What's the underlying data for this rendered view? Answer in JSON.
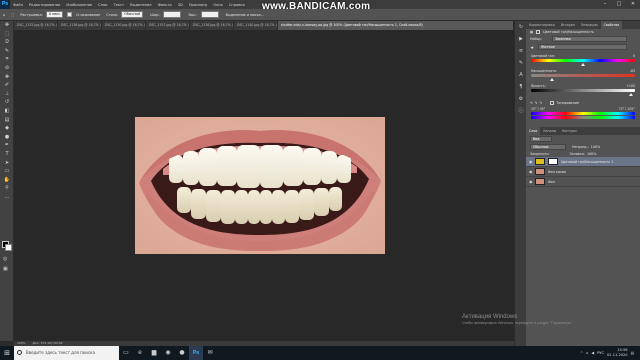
{
  "app": {
    "logo": "Ps",
    "menu": [
      "Файл",
      "Редактирование",
      "Изображение",
      "Слои",
      "Текст",
      "Выделение",
      "Фильтр",
      "3D",
      "Просмотр",
      "Окно",
      "Справка"
    ],
    "watermark": "www.BANDICAM.com"
  },
  "options": {
    "feather_label": "Растушевка:",
    "feather_value": "0 пикс",
    "antialias_label": "Сглаживание",
    "style_label": "Стиль:",
    "style_value": "Обычный",
    "width_label": "Шир.:",
    "height_label": "Выс.:",
    "refine_button": "Выделение и маска..."
  },
  "tabs": [
    {
      "label": "DSC_1132.jpg @ 16,7% (RGB/8)",
      "active": false
    },
    {
      "label": "DSC_1136.jpg @ 16,7% (RGB/8)",
      "active": false
    },
    {
      "label": "DSC_1130.jpg @ 16,7% (RGB/8)",
      "active": false
    },
    {
      "label": "DSC_1157.jpg @ 16,7% (RGB/8)",
      "active": false
    },
    {
      "label": "DSC_1138.jpg @ 16,7% (RGB/8)",
      "active": false
    },
    {
      "label": "DSC_1140.jpg @ 16,7% (RGB/8)",
      "active": false
    },
    {
      "label": "shutter-zuby-v-lozovoy-po.jpg @ 100% (Цветовой тон/Насыщенность 1, Слой-маска/8)",
      "active": true
    }
  ],
  "tools": [
    "move",
    "marquee",
    "lasso",
    "quick-select",
    "crop",
    "eyedropper",
    "heal",
    "brush",
    "stamp",
    "history-brush",
    "eraser",
    "gradient",
    "blur",
    "dodge",
    "pen",
    "type",
    "path-select",
    "shape",
    "hand",
    "zoom",
    "more"
  ],
  "statusbar": {
    "zoom": "100%",
    "doc": "Док: 372,1K/744,3K"
  },
  "properties": {
    "tabs": [
      "Корректировка",
      "История",
      "Операции",
      "Свойства"
    ],
    "active_tab": "Свойства",
    "title": "Цветовой тон/Насыщенность",
    "preset_label": "Набор:",
    "preset_value": "Заказная",
    "channel_value": "Желтые",
    "hue_label": "Цветовой тон:",
    "hue_value": "0",
    "saturation_label": "Насыщенность:",
    "saturation_value": "-63",
    "lightness_label": "Яркость:",
    "lightness_value": "+100",
    "colorize_label": "Тонирование",
    "range_left": "15° / 45°",
    "range_right": "75° \\ 105°"
  },
  "layers_panel": {
    "tabs": [
      "Слои",
      "Каналы",
      "Контуры"
    ],
    "active_tab": "Слои",
    "kind_label": "Вид",
    "blend_mode": "Обычные",
    "opacity_label": "Непрозр.:",
    "opacity_value": "100%",
    "lock_label": "Закрепить:",
    "fill_label": "Заливка:",
    "fill_value": "100%",
    "layers": [
      {
        "name": "Цветовой тон/Насыщенность 1",
        "active": true
      },
      {
        "name": "Фон копия",
        "active": false
      },
      {
        "name": "Фон",
        "active": false
      }
    ]
  },
  "taskbar": {
    "search_placeholder": "Введите здесь текст для поиска",
    "time": "15:56",
    "date": "02.11.2020",
    "lang": "РУС"
  },
  "activation": {
    "title": "Активация Windows",
    "subtitle": "Чтобы активировать Windows, перейдите в раздел \"Параметры\"."
  }
}
